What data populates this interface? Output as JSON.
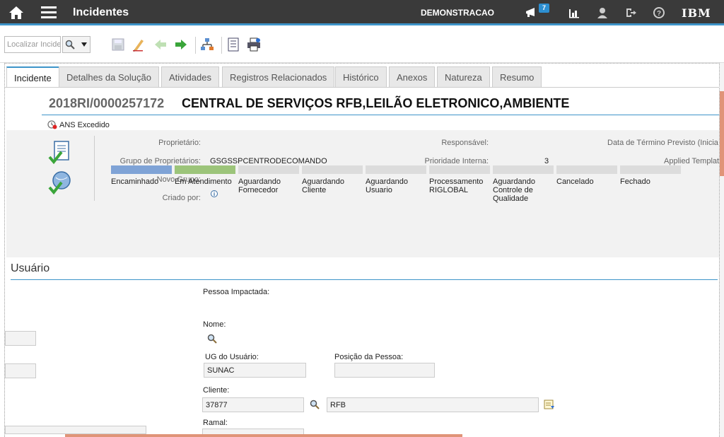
{
  "topbar": {
    "title": "Incidentes",
    "user": "DEMONSTRACAO",
    "notifications": "7",
    "brand": "IBM"
  },
  "toolbar": {
    "search_placeholder": "Localizar Incidente"
  },
  "tabs": [
    "Incidente",
    "Detalhes da Solução",
    "Atividades",
    "Registros Relacionados",
    "Histórico",
    "Anexos",
    "Natureza",
    "Resumo"
  ],
  "record": {
    "id": "2018RI/0000257172",
    "description": "CENTRAL DE SERVIÇOS RFB,LEILÃO ELETRONICO,AMBIENTE",
    "sla": "ANS Excedido"
  },
  "fields": {
    "owner_label": "Proprietário:",
    "owner_group_label": "Grupo de Proprietários:",
    "owner_group_value": "GSGSSPCENTRODECOMANDO",
    "new_group_label": "Novo Grupo:",
    "created_by_label": "Criado por:",
    "responsible_label": "Responsável:",
    "internal_priority_label": "Prioridade Interna:",
    "internal_priority_value": "3",
    "end_date_label": "Data de Término Previsto (Inicia",
    "applied_template_label": "Applied Templat"
  },
  "statuses": [
    {
      "label": "Encaminhado",
      "color": "#7fa3d6"
    },
    {
      "label": "Em Atendimento",
      "color": "#9cc47a"
    },
    {
      "label": "Aguardando Fornecedor",
      "color": "#dcdcdc"
    },
    {
      "label": "Aguardando Cliente",
      "color": "#dcdcdc"
    },
    {
      "label": "Aguardando Usuario",
      "color": "#dcdcdc"
    },
    {
      "label": "Processamento RIGLOBAL",
      "color": "#dcdcdc"
    },
    {
      "label": "Aguardando Controle de Qualidade",
      "color": "#dcdcdc"
    },
    {
      "label": "Cancelado",
      "color": "#dcdcdc"
    },
    {
      "label": "Fechado",
      "color": "#dcdcdc"
    }
  ],
  "user_section": {
    "title": "Usuário",
    "affected_person_label": "Pessoa Impactada:",
    "name_label": "Nome:",
    "ug_label": "UG do Usuário:",
    "ug_value": "SUNAC",
    "position_label": "Posição da Pessoa:",
    "client_label": "Cliente:",
    "client_value": "37877",
    "client_desc": "RFB",
    "extension_label": "Ramal:"
  }
}
